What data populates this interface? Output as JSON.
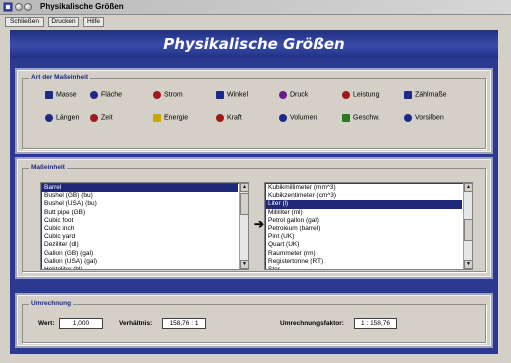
{
  "window": {
    "title": "Physikalische Größen"
  },
  "menu": [
    {
      "label": "Schließen"
    },
    {
      "label": "Drucken"
    },
    {
      "label": "Hilfe"
    }
  ],
  "banner": {
    "title": "Physikalische Größen"
  },
  "unit_type": {
    "legend": "Art der Maßeinheit",
    "options": [
      {
        "label": "Masse",
        "icon": "weight-icon",
        "color": "#1d2a86"
      },
      {
        "label": "Fläche",
        "icon": "area-icon",
        "color": "#1d2a86"
      },
      {
        "label": "Strom",
        "icon": "current-icon",
        "color": "#a01818"
      },
      {
        "label": "Winkel",
        "icon": "angle-icon",
        "color": "#1d2a86"
      },
      {
        "label": "Druck",
        "icon": "pressure-icon",
        "color": "#6a1d86"
      },
      {
        "label": "Leistung",
        "icon": "power-icon",
        "color": "#a01818"
      },
      {
        "label": "Zählmaße",
        "icon": "count-icon",
        "color": "#1d2a86"
      },
      {
        "label": "Längen",
        "icon": "length-icon",
        "color": "#1d2a86"
      },
      {
        "label": "Zeit",
        "icon": "clock-icon",
        "color": "#a01818"
      },
      {
        "label": "Energie",
        "icon": "bulb-icon",
        "color": "#c8a800"
      },
      {
        "label": "Kraft",
        "icon": "force-icon",
        "color": "#a01818"
      },
      {
        "label": "Volumen",
        "icon": "volume-icon",
        "color": "#1d2a86"
      },
      {
        "label": "Geschw.",
        "icon": "speed-icon",
        "color": "#2a7a20"
      },
      {
        "label": "Vorsilben",
        "icon": "prefix-icon",
        "color": "#1d2a86"
      }
    ]
  },
  "unit_select": {
    "legend": "Maßeinheit",
    "left_items": [
      "Barrel",
      "Bushel (GB) (bu)",
      "Bushel (USA) (bu)",
      "Butt pipe (GB)",
      "Cubic foot",
      "Cubic inch",
      "Cubic yard",
      "Deziliter (dl)",
      "Gallon (GB) (gal)",
      "Gallon (USA) (gal)",
      "Hektoliter (hl)"
    ],
    "left_selected": "Barrel",
    "right_items": [
      "Kubikmillimeter (mm^3)",
      "Kubikzentimeter (cm^3)",
      "Liter (l)",
      "Milliliter (ml)",
      "Petrol gallon (gal)",
      "Petroleum (barrel)",
      "Pint (UK)",
      "Quart (UK)",
      "Raummeter (rm)",
      "Registertonne (RT)",
      "Ster"
    ],
    "right_selected": "Liter (l)",
    "arrow": "➔"
  },
  "conversion": {
    "legend": "Umrechnung",
    "wert_label": "Wert:",
    "wert_value": "1,000",
    "verhaeltnis_label": "Verhältnis:",
    "verhaeltnis_value": "158,76 : 1",
    "faktor_label": "Umrechnungsfaktor:",
    "faktor_value": "1 : 158,76"
  }
}
